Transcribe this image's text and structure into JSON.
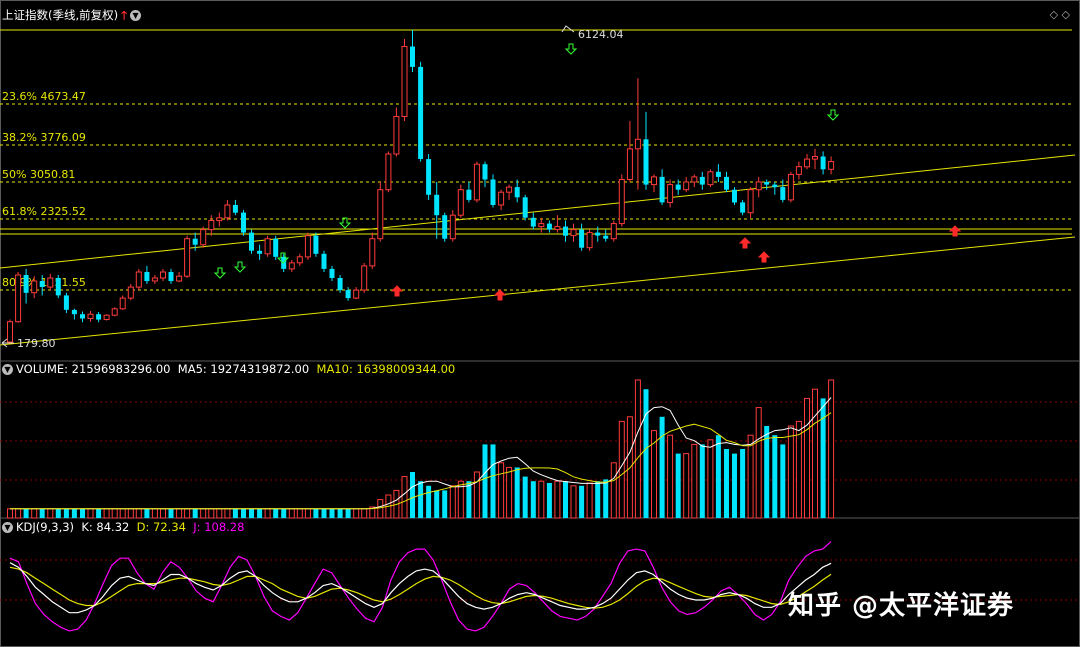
{
  "header": {
    "title": "上证指数(季线,前复权)",
    "volume_label": "VOLUME: 21596983296.00",
    "ma5_label": "MA5: 19274319872.00",
    "ma10_label": "MA10: 16398009344.00",
    "kdj_label": "KDJ(9,3,3)",
    "k_label": "K: 84.32",
    "d_label": "D: 72.34",
    "j_label": "J: 108.28"
  },
  "colors": {
    "up": "#ff3b3b",
    "down": "#00e5ff",
    "fib": "#e6e600",
    "ma5": "#ffffff",
    "ma10": "#e6e600",
    "j": "#ff00ff"
  },
  "icons": {
    "header_arrow": "red-up-arrow-icon",
    "header_menu": "chevron-down-circle-icon",
    "top_right": "diamond-icon"
  },
  "watermark": "知乎 @太平洋证券",
  "chart_data": {
    "type": "candlestick",
    "ylim": [
      100,
      6300
    ],
    "high_label": "6124.04",
    "low_label": "179.80",
    "fib_levels": [
      {
        "label": "23.6% 4673.47",
        "value": 4673.47
      },
      {
        "label": "38.2% 3776.09",
        "value": 3776.09
      },
      {
        "label": "50% 3050.81",
        "value": 3050.81
      },
      {
        "label": "61.8% 2325.52",
        "value": 2325.52
      },
      {
        "label": "80.9% 1151.55",
        "value": 1151.55
      }
    ],
    "candles": [
      [
        180,
        560,
        179,
        600
      ],
      [
        560,
        1400,
        540,
        1450
      ],
      [
        1400,
        1100,
        900,
        1500
      ],
      [
        1100,
        1300,
        1000,
        1380
      ],
      [
        1300,
        1200,
        1050,
        1400
      ],
      [
        1200,
        1350,
        1150,
        1420
      ],
      [
        1350,
        1050,
        1000,
        1400
      ],
      [
        1050,
        780,
        720,
        1100
      ],
      [
        780,
        700,
        600,
        800
      ],
      [
        700,
        620,
        550,
        750
      ],
      [
        620,
        700,
        560,
        760
      ],
      [
        700,
        600,
        550,
        740
      ],
      [
        600,
        680,
        580,
        700
      ],
      [
        680,
        800,
        660,
        830
      ],
      [
        800,
        1000,
        780,
        1050
      ],
      [
        1000,
        1200,
        960,
        1250
      ],
      [
        1200,
        1450,
        1150,
        1500
      ],
      [
        1450,
        1300,
        1250,
        1550
      ],
      [
        1300,
        1350,
        1250,
        1400
      ],
      [
        1350,
        1450,
        1300,
        1500
      ],
      [
        1450,
        1300,
        1250,
        1500
      ],
      [
        1300,
        1380,
        1280,
        1450
      ],
      [
        1380,
        2000,
        1350,
        2050
      ],
      [
        2000,
        1900,
        1800,
        2100
      ],
      [
        1900,
        2150,
        1850,
        2200
      ],
      [
        2150,
        2300,
        2050,
        2400
      ],
      [
        2300,
        2350,
        2200,
        2450
      ],
      [
        2350,
        2600,
        2300,
        2700
      ],
      [
        2600,
        2450,
        2400,
        2700
      ],
      [
        2450,
        2100,
        2050,
        2500
      ],
      [
        2100,
        1800,
        1750,
        2150
      ],
      [
        1800,
        1750,
        1650,
        1900
      ],
      [
        1750,
        2000,
        1700,
        2050
      ],
      [
        2000,
        1700,
        1650,
        2050
      ],
      [
        1700,
        1500,
        1450,
        1750
      ],
      [
        1500,
        1600,
        1450,
        1650
      ],
      [
        1600,
        1700,
        1550,
        1750
      ],
      [
        1700,
        2050,
        1650,
        2100
      ],
      [
        2050,
        1750,
        1700,
        2100
      ],
      [
        1750,
        1500,
        1450,
        1800
      ],
      [
        1500,
        1350,
        1300,
        1550
      ],
      [
        1350,
        1150,
        1100,
        1400
      ],
      [
        1150,
        1000,
        950,
        1200
      ],
      [
        1000,
        1150,
        980,
        1200
      ],
      [
        1150,
        1550,
        1100,
        1600
      ],
      [
        1550,
        2000,
        1500,
        2100
      ],
      [
        2000,
        2900,
        1950,
        3050
      ],
      [
        2900,
        3600,
        2850,
        3650
      ],
      [
        3600,
        4400,
        3550,
        4600
      ],
      [
        4400,
        5800,
        4300,
        5950
      ],
      [
        5800,
        5400,
        5300,
        6124
      ],
      [
        5400,
        3500,
        3450,
        5500
      ],
      [
        3500,
        2800,
        2700,
        3600
      ],
      [
        2800,
        2400,
        2000,
        3050
      ],
      [
        2400,
        2000,
        1950,
        2450
      ],
      [
        2000,
        2400,
        1950,
        2500
      ],
      [
        2400,
        2900,
        2350,
        3000
      ],
      [
        2900,
        2700,
        2650,
        3050
      ],
      [
        2700,
        3400,
        2650,
        3450
      ],
      [
        3400,
        3100,
        2950,
        3450
      ],
      [
        3100,
        2600,
        2550,
        3200
      ],
      [
        2600,
        2850,
        2500,
        2900
      ],
      [
        2850,
        2950,
        2700,
        3000
      ],
      [
        2950,
        2750,
        2650,
        3100
      ],
      [
        2750,
        2350,
        2300,
        2800
      ],
      [
        2350,
        2200,
        2150,
        2450
      ],
      [
        2200,
        2250,
        2100,
        2350
      ],
      [
        2250,
        2150,
        2100,
        2300
      ],
      [
        2150,
        2200,
        2100,
        2400
      ],
      [
        2200,
        2050,
        1950,
        2300
      ],
      [
        2050,
        2150,
        1950,
        2250
      ],
      [
        2150,
        1850,
        1800,
        2250
      ],
      [
        1850,
        2100,
        1800,
        2150
      ],
      [
        2100,
        2050,
        1950,
        2200
      ],
      [
        2050,
        2000,
        1950,
        2150
      ],
      [
        2000,
        2250,
        1950,
        2300
      ],
      [
        2250,
        3100,
        2200,
        3200
      ],
      [
        3100,
        3700,
        3050,
        4300
      ],
      [
        3700,
        3900,
        2900,
        5180
      ],
      [
        3900,
        3000,
        2900,
        4500
      ],
      [
        3000,
        3150,
        2850,
        3200
      ],
      [
        3150,
        2650,
        2600,
        3300
      ],
      [
        2650,
        3000,
        2550,
        3100
      ],
      [
        3000,
        2900,
        2800,
        3100
      ],
      [
        2900,
        3050,
        2850,
        3150
      ],
      [
        3050,
        3150,
        2950,
        3200
      ],
      [
        3150,
        3000,
        2900,
        3250
      ],
      [
        3000,
        3250,
        2950,
        3300
      ],
      [
        3250,
        3150,
        3050,
        3400
      ],
      [
        3150,
        2900,
        2850,
        3250
      ],
      [
        2900,
        2650,
        2600,
        2950
      ],
      [
        2650,
        2450,
        2400,
        2700
      ],
      [
        2450,
        2900,
        2350,
        2950
      ],
      [
        2900,
        3050,
        2750,
        3150
      ],
      [
        3050,
        3000,
        2900,
        3100
      ],
      [
        3000,
        2950,
        2800,
        3050
      ],
      [
        2950,
        2700,
        2650,
        3100
      ],
      [
        2700,
        3200,
        2650,
        3250
      ],
      [
        3200,
        3350,
        3100,
        3450
      ],
      [
        3350,
        3500,
        3300,
        3600
      ],
      [
        3500,
        3550,
        3300,
        3700
      ],
      [
        3550,
        3300,
        3200,
        3650
      ],
      [
        3300,
        3450,
        3200,
        3550
      ]
    ],
    "volume": [
      1,
      1,
      1,
      1,
      1,
      1,
      1,
      1,
      1,
      1,
      1,
      1,
      1,
      1,
      1,
      1,
      1,
      1,
      1,
      1,
      1,
      1,
      1,
      1,
      1,
      1,
      1,
      1,
      1,
      1,
      1,
      1,
      1,
      1,
      1,
      1,
      1,
      1,
      1,
      1,
      1,
      1,
      1,
      1,
      1,
      1.2,
      2,
      2.5,
      3,
      4.5,
      5,
      4,
      3.5,
      3,
      3,
      3.5,
      4,
      4,
      5,
      8,
      8,
      6,
      5.5,
      5.5,
      4.5,
      4,
      4,
      3.8,
      4,
      4,
      3.5,
      3.5,
      3.8,
      4,
      4.2,
      6,
      10.5,
      11,
      15,
      14,
      9.5,
      11,
      9,
      7,
      7,
      8,
      8,
      8.5,
      9,
      7.5,
      7,
      7.5,
      9,
      12,
      10,
      9,
      8,
      10,
      10.5,
      13,
      14,
      13,
      15
    ],
    "kdj": {
      "k": [
        85,
        80,
        70,
        58,
        50,
        42,
        36,
        30,
        30,
        33,
        38,
        48,
        60,
        68,
        70,
        66,
        62,
        60,
        66,
        72,
        72,
        68,
        62,
        58,
        55,
        60,
        68,
        74,
        76,
        70,
        60,
        52,
        46,
        42,
        42,
        46,
        52,
        60,
        62,
        58,
        52,
        46,
        40,
        36,
        40,
        52,
        62,
        70,
        76,
        78,
        76,
        68,
        58,
        48,
        40,
        36,
        34,
        36,
        40,
        46,
        50,
        52,
        50,
        46,
        42,
        38,
        36,
        34,
        34,
        36,
        40,
        46,
        56,
        66,
        74,
        76,
        72,
        64,
        56,
        50,
        46,
        44,
        44,
        46,
        50,
        52,
        50,
        46,
        40,
        36,
        36,
        40,
        50,
        58,
        66,
        72,
        80,
        84.32
      ],
      "d": [
        80,
        78,
        74,
        68,
        62,
        56,
        50,
        44,
        40,
        38,
        38,
        42,
        48,
        54,
        60,
        62,
        62,
        62,
        63,
        66,
        68,
        68,
        66,
        64,
        61,
        60,
        62,
        66,
        70,
        70,
        66,
        62,
        56,
        52,
        48,
        46,
        48,
        52,
        56,
        57,
        55,
        52,
        48,
        44,
        42,
        45,
        50,
        56,
        62,
        67,
        70,
        69,
        66,
        61,
        55,
        49,
        44,
        41,
        40,
        42,
        45,
        48,
        49,
        48,
        46,
        43,
        40,
        38,
        36,
        35,
        36,
        39,
        44,
        51,
        59,
        65,
        68,
        67,
        63,
        59,
        55,
        51,
        48,
        47,
        48,
        49,
        50,
        49,
        46,
        43,
        40,
        39,
        42,
        47,
        53,
        59,
        66,
        72.34
      ],
      "j": [
        90,
        86,
        62,
        40,
        28,
        20,
        14,
        10,
        12,
        22,
        40,
        62,
        82,
        90,
        90,
        74,
        62,
        56,
        74,
        86,
        80,
        68,
        54,
        46,
        42,
        60,
        80,
        92,
        88,
        70,
        48,
        32,
        26,
        22,
        30,
        46,
        62,
        78,
        74,
        60,
        46,
        34,
        24,
        20,
        36,
        66,
        86,
        96,
        100,
        100,
        88,
        66,
        42,
        22,
        12,
        10,
        14,
        26,
        40,
        56,
        62,
        60,
        52,
        42,
        32,
        26,
        24,
        22,
        26,
        34,
        48,
        62,
        84,
        98,
        100,
        98,
        80,
        58,
        42,
        32,
        28,
        30,
        36,
        44,
        54,
        58,
        50,
        40,
        28,
        22,
        28,
        42,
        66,
        80,
        92,
        98,
        100,
        108.28
      ]
    }
  }
}
